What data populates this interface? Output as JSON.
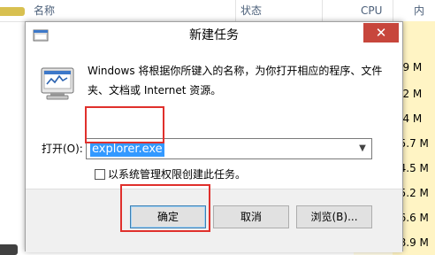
{
  "task_manager": {
    "columns": {
      "name": "名称",
      "status": "状态",
      "cpu": "CPU",
      "mem": "内"
    },
    "rows": [
      "9.9 M",
      "7.2 M",
      "6.4 M",
      "15.7 M",
      "44.5 M",
      "45.2 M",
      "16.6 M",
      "28.9 M"
    ]
  },
  "dialog": {
    "title": "新建任务",
    "close_glyph": "✕",
    "description": "Windows 将根据你所键入的名称，为你打开相应的程序、文件夹、文档或 Internet 资源。",
    "open_label": "打开(O):",
    "open_value": "explorer.exe",
    "admin_checkbox_label": "以系统管理权限创建此任务。",
    "ok_label": "确定",
    "cancel_label": "取消",
    "browse_label": "浏览(B)...",
    "annotation_color": "#e0302c"
  }
}
